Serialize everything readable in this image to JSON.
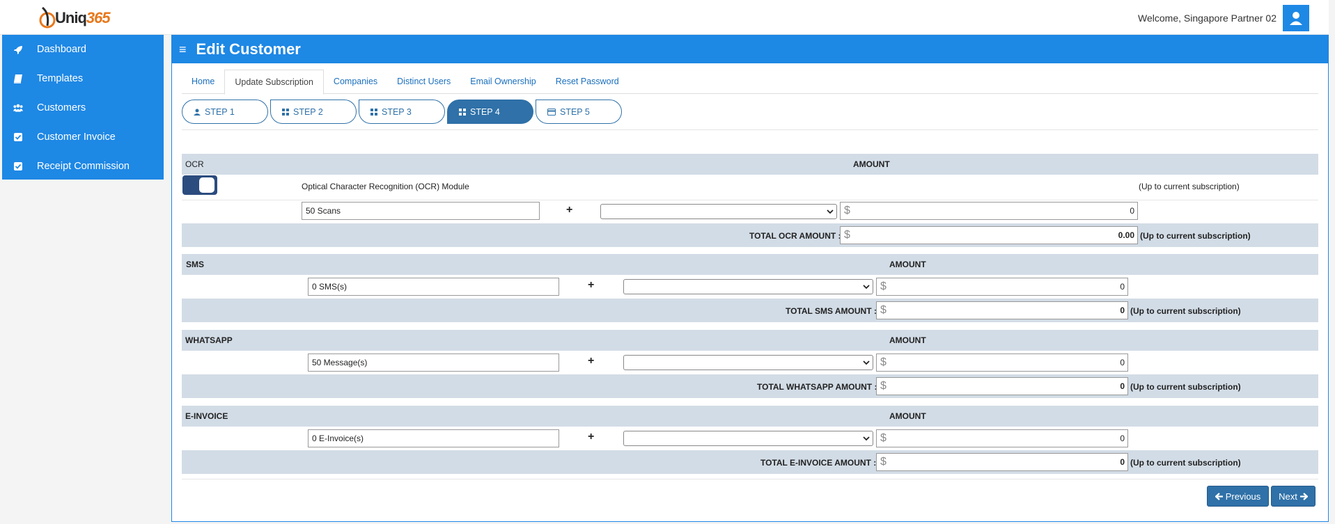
{
  "header": {
    "logo_text_a": "Uniq",
    "logo_text_b": "365",
    "welcome": "Welcome, Singapore Partner 02"
  },
  "sidebar": {
    "items": [
      {
        "label": "Dashboard",
        "icon": "rocket-icon"
      },
      {
        "label": "Templates",
        "icon": "book-icon"
      },
      {
        "label": "Customers",
        "icon": "users-icon"
      },
      {
        "label": "Customer Invoice",
        "icon": "checkbox-icon"
      },
      {
        "label": "Receipt Commission",
        "icon": "checkbox-icon"
      }
    ]
  },
  "page": {
    "title": "Edit Customer",
    "tabs": [
      "Home",
      "Update Subscription",
      "Companies",
      "Distinct Users",
      "Email Ownership",
      "Reset Password"
    ],
    "active_tab": "Update Subscription",
    "steps": [
      "STEP 1",
      "STEP 2",
      "STEP 3",
      "STEP 4",
      "STEP 5"
    ],
    "active_step": "STEP 4"
  },
  "ocr": {
    "header": "OCR",
    "amount_header": "AMOUNT",
    "module_label": "Optical Character Recognition (OCR) Module",
    "note": "(Up to current subscription)",
    "enabled": true,
    "quantity": "50 Scans",
    "amount": "0",
    "total_label": "TOTAL OCR AMOUNT :",
    "total": "0.00",
    "total_note": "(Up to current subscription)"
  },
  "sms": {
    "header": "SMS",
    "amount_header": "AMOUNT",
    "quantity": "0 SMS(s)",
    "amount": "0",
    "total_label": "TOTAL SMS AMOUNT :",
    "total": "0",
    "total_note": "(Up to current subscription)"
  },
  "whatsapp": {
    "header": "WHATSAPP",
    "amount_header": "AMOUNT",
    "quantity": "50 Message(s)",
    "amount": "0",
    "total_label": "TOTAL WHATSAPP AMOUNT :",
    "total": "0",
    "total_note": "(Up to current subscription)"
  },
  "einvoice": {
    "header": "E-INVOICE",
    "amount_header": "AMOUNT",
    "quantity": "0 E-Invoice(s)",
    "amount": "0",
    "total_label": "TOTAL E-INVOICE AMOUNT :",
    "total": "0",
    "total_note": "(Up to current subscription)"
  },
  "buttons": {
    "previous": "Previous",
    "next": "Next"
  },
  "colors": {
    "primary": "#1e88e5",
    "step": "#2f71a8",
    "shade": "#d2dce6",
    "brand_orange": "#e8781c"
  }
}
